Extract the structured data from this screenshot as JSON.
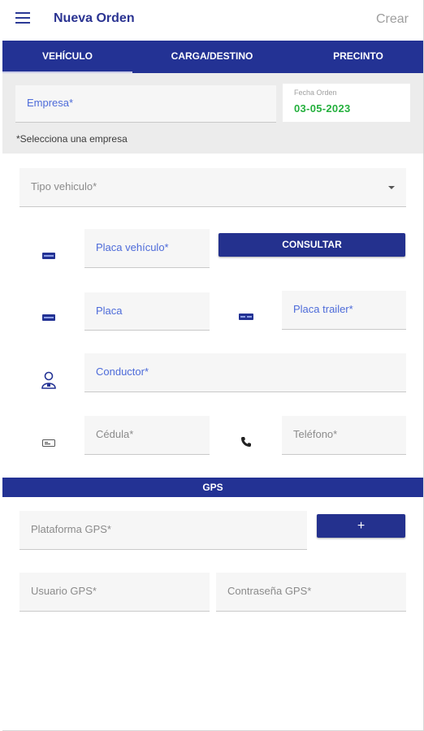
{
  "header": {
    "title": "Nueva Orden",
    "action": "Crear",
    "menu_icon": "hamburger-menu-icon"
  },
  "tabs": [
    {
      "label": "VEHÍCULO",
      "active": true
    },
    {
      "label": "CARGA/DESTINO",
      "active": false
    },
    {
      "label": "PRECINTO",
      "active": false
    }
  ],
  "empresa": {
    "label": "Empresa*",
    "hint": "*Selecciona una empresa"
  },
  "fecha": {
    "label": "Fecha Orden",
    "value": "03-05-2023"
  },
  "vehiculo": {
    "tipo_label": "Tipo vehiculo*",
    "placa_vehiculo_label": "Placa vehículo*",
    "consultar_label": "CONSULTAR",
    "placa_label": "Placa",
    "placa_trailer_label": "Placa trailer*",
    "conductor_label": "Conductor*",
    "cedula_label": "Cédula*",
    "telefono_label": "Teléfono*"
  },
  "gps": {
    "title": "GPS",
    "plataforma_label": "Plataforma GPS*",
    "add_label": "+",
    "usuario_label": "Usuario GPS*",
    "contrasena_label": "Contraseña GPS*"
  },
  "colors": {
    "primary": "#233294",
    "accent_text": "#4d6bd9",
    "date_green": "#24b03d"
  }
}
